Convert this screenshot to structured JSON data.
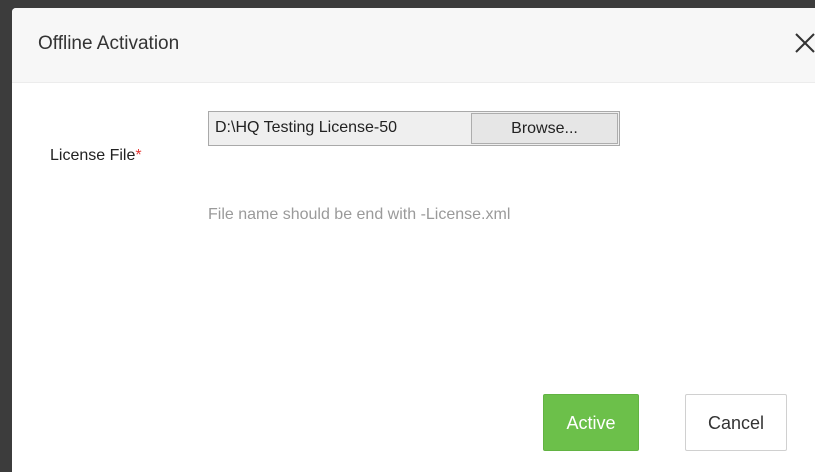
{
  "dialog": {
    "title": "Offline Activation",
    "close_icon": "close-icon"
  },
  "form": {
    "license_label": "License File",
    "required_mark": "*",
    "file_value": "D:\\HQ Testing License-50",
    "browse_label": "Browse...",
    "hint": "File name should be end with -License.xml"
  },
  "actions": {
    "active_label": "Active",
    "cancel_label": "Cancel"
  },
  "colors": {
    "backdrop": "#3c3c3c",
    "header_bg": "#f7f7f7",
    "primary": "#6cc04a",
    "required": "#e53935",
    "hint_text": "#9a9a9a"
  }
}
